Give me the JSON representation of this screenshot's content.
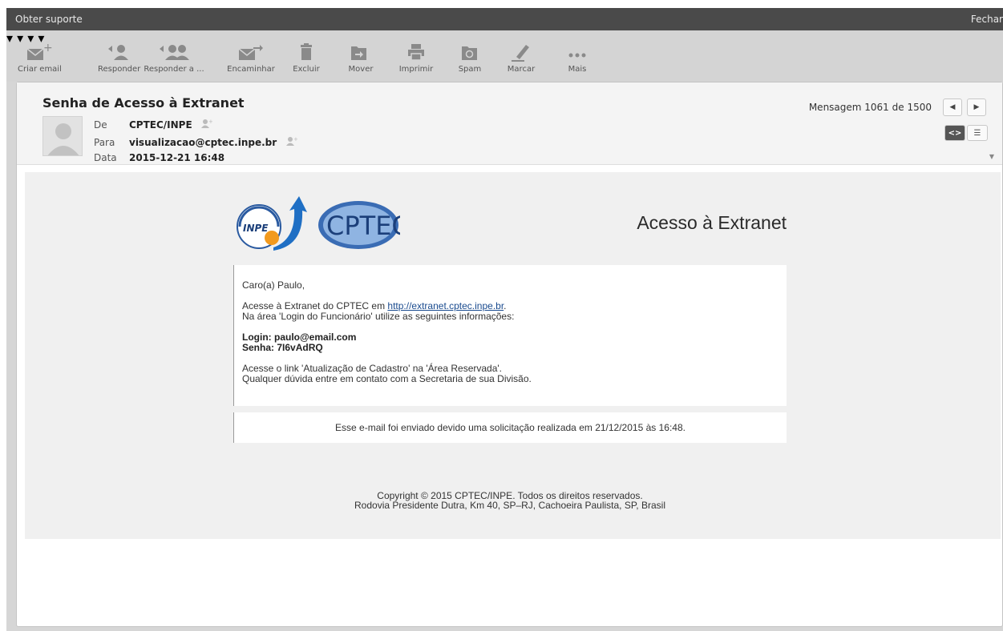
{
  "topbar": {
    "support": "Obter suporte",
    "close": "Fechar"
  },
  "toolbar": {
    "create": "Criar email",
    "reply": "Responder",
    "reply_all": "Responder a ...",
    "forward": "Encaminhar",
    "delete": "Excluir",
    "move": "Mover",
    "print": "Imprimir",
    "spam": "Spam",
    "mark": "Marcar",
    "more": "Mais"
  },
  "header": {
    "subject": "Senha de Acesso à Extranet",
    "from_label": "De",
    "from_value": "CPTEC/INPE",
    "to_label": "Para",
    "to_value": "visualizacao@cptec.inpe.br",
    "date_label": "Data",
    "date_value": "2015-12-21 16:48",
    "counter": "Mensagem 1061 de 1500"
  },
  "email": {
    "logo_inpe": "INPE",
    "logo_cptec": "CPTEC",
    "title": "Acesso à Extranet",
    "greeting": "Caro(a) Paulo,",
    "line1_prefix": "Acesse à Extranet do CPTEC em ",
    "link": "http://extranet.cptec.inpe.br",
    "line1_suffix": ".",
    "line2": "Na área 'Login do Funcionário' utilize as seguintes informações:",
    "login": "Login: paulo@email.com",
    "password": "Senha: 7I6vAdRQ",
    "line3": "Acesse o link 'Atualização de Cadastro' na 'Área Reservada'.",
    "line4": "Qualquer dúvida entre em contato com a Secretaria de sua Divisão.",
    "note": "Esse e-mail foi enviado devido uma solicitação realizada em 21/12/2015 às 16:48.",
    "copyright": "Copyright © 2015 CPTEC/INPE. Todos os direitos reservados.",
    "address": "Rodovia Presidente Dutra, Km 40, SP–RJ, Cachoeira Paulista, SP, Brasil"
  }
}
